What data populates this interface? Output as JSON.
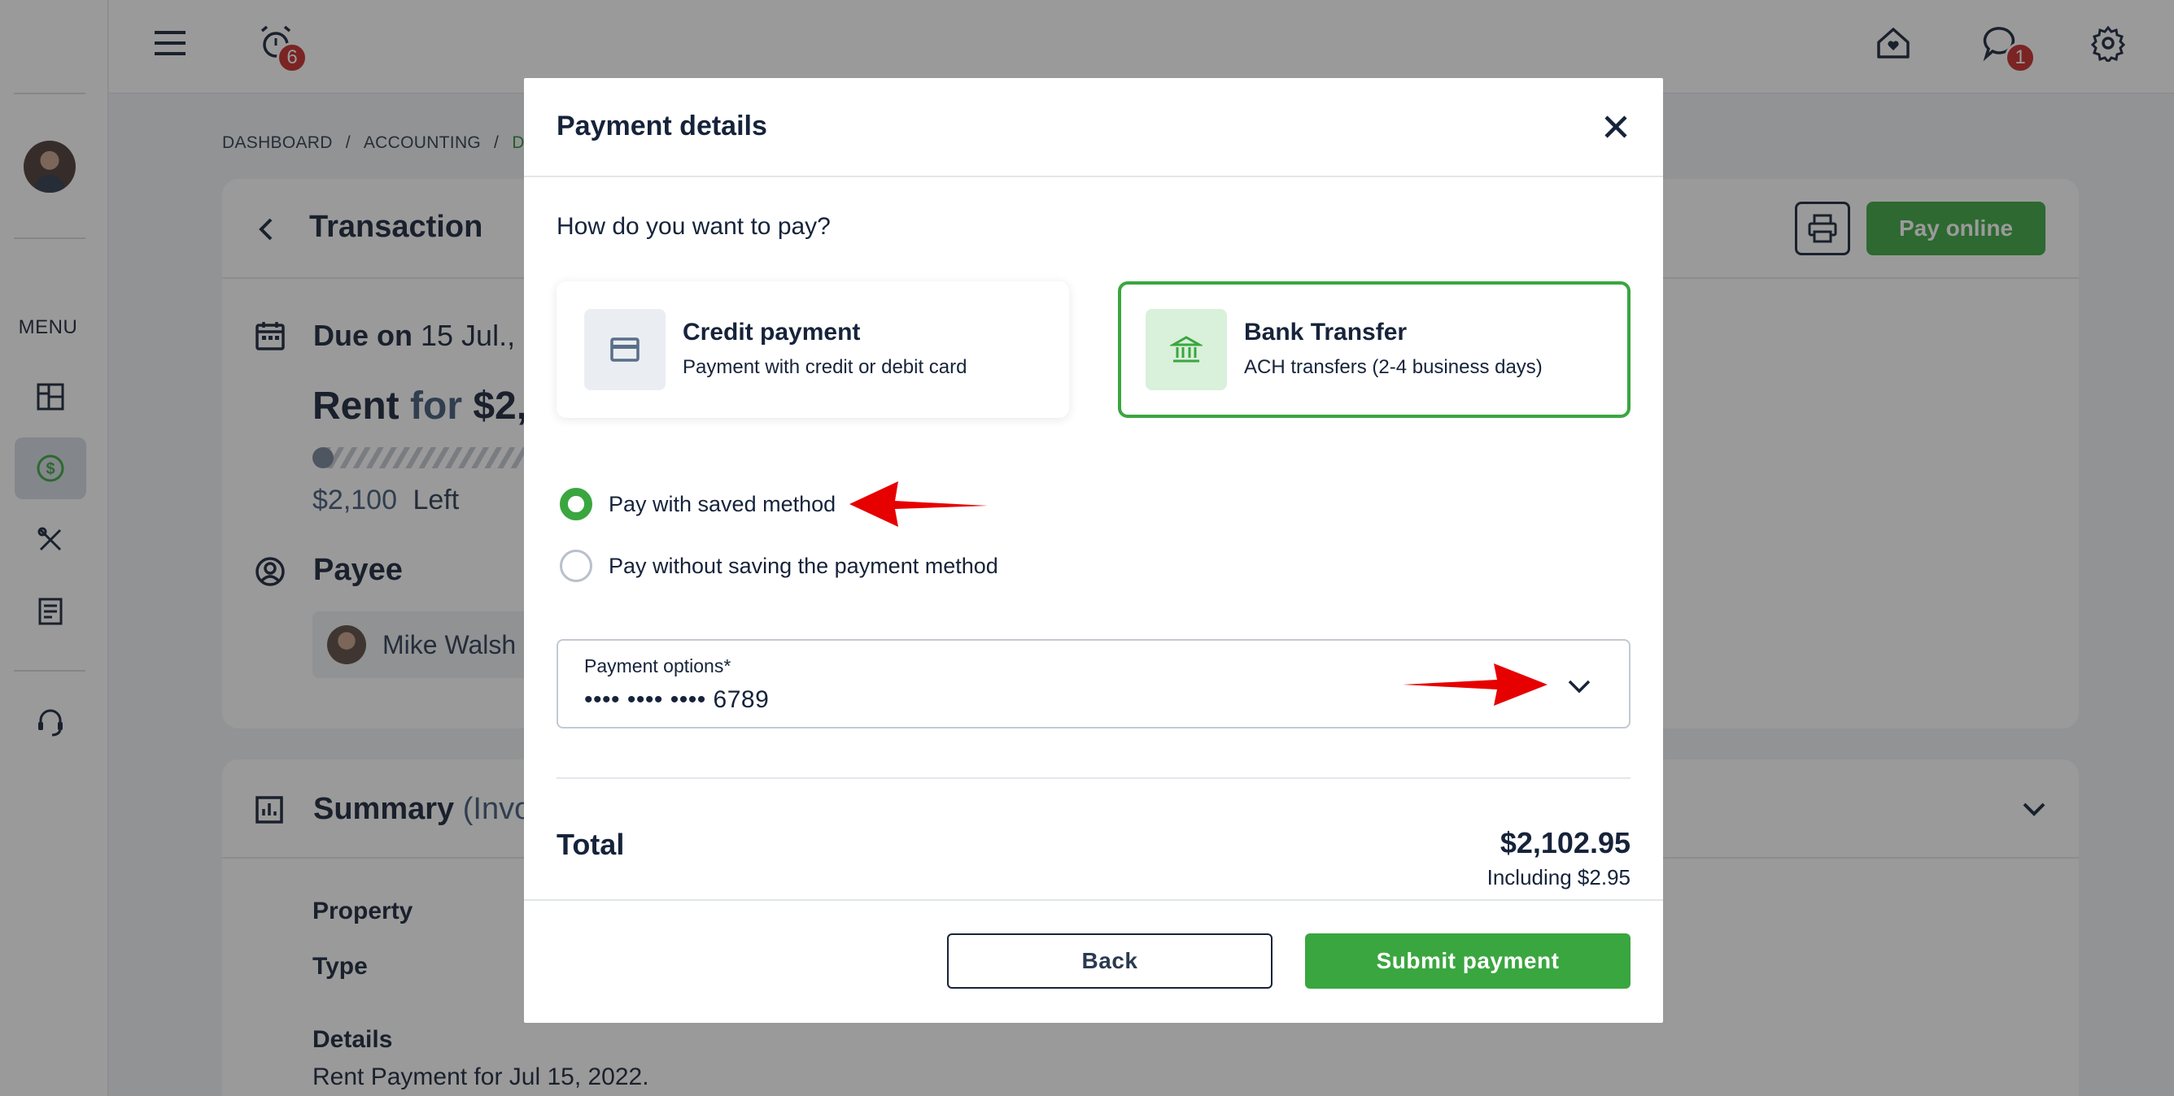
{
  "topbar": {
    "alarm_badge": "6",
    "chat_badge": "1"
  },
  "sidebar": {
    "menu_label": "MENU"
  },
  "breadcrumb": {
    "items": [
      "DASHBOARD",
      "ACCOUNTING",
      "DET"
    ],
    "separator": "/"
  },
  "transaction": {
    "title": "Transaction",
    "due_prefix": "Due on",
    "due_date": "15 Jul.,",
    "rent_label": "Rent",
    "rent_for": "for",
    "rent_amount": "$2,",
    "left_amount": "$2,100",
    "left_label": "Left",
    "payee_heading": "Payee",
    "payee_name": "Mike Walsh",
    "pay_online": "Pay online"
  },
  "summary": {
    "title": "Summary",
    "subtitle": "(Invoi",
    "property_label": "Property",
    "type_label": "Type",
    "details_label": "Details",
    "details_value": "Rent Payment for Jul 15, 2022."
  },
  "modal": {
    "title": "Payment details",
    "question": "How do you want to pay?",
    "methods": [
      {
        "title": "Credit payment",
        "subtitle": "Payment with credit or debit card",
        "icon": "credit-card-icon",
        "selected": false
      },
      {
        "title": "Bank Transfer",
        "subtitle": "ACH transfers (2-4 business days)",
        "icon": "bank-icon",
        "selected": true
      }
    ],
    "radio_saved": "Pay with saved method",
    "radio_unsaved": "Pay without saving the payment method",
    "payment_options_label": "Payment options*",
    "payment_options_value": "•••• •••• •••• 6789",
    "total_label": "Total",
    "total_amount": "$2,102.95",
    "total_sub": "Including $2.95",
    "back_label": "Back",
    "submit_label": "Submit payment"
  },
  "colors": {
    "accent": "#3aa63f",
    "navy": "#16233a",
    "badge": "#c62828",
    "annotation_arrow": "#e60000"
  }
}
